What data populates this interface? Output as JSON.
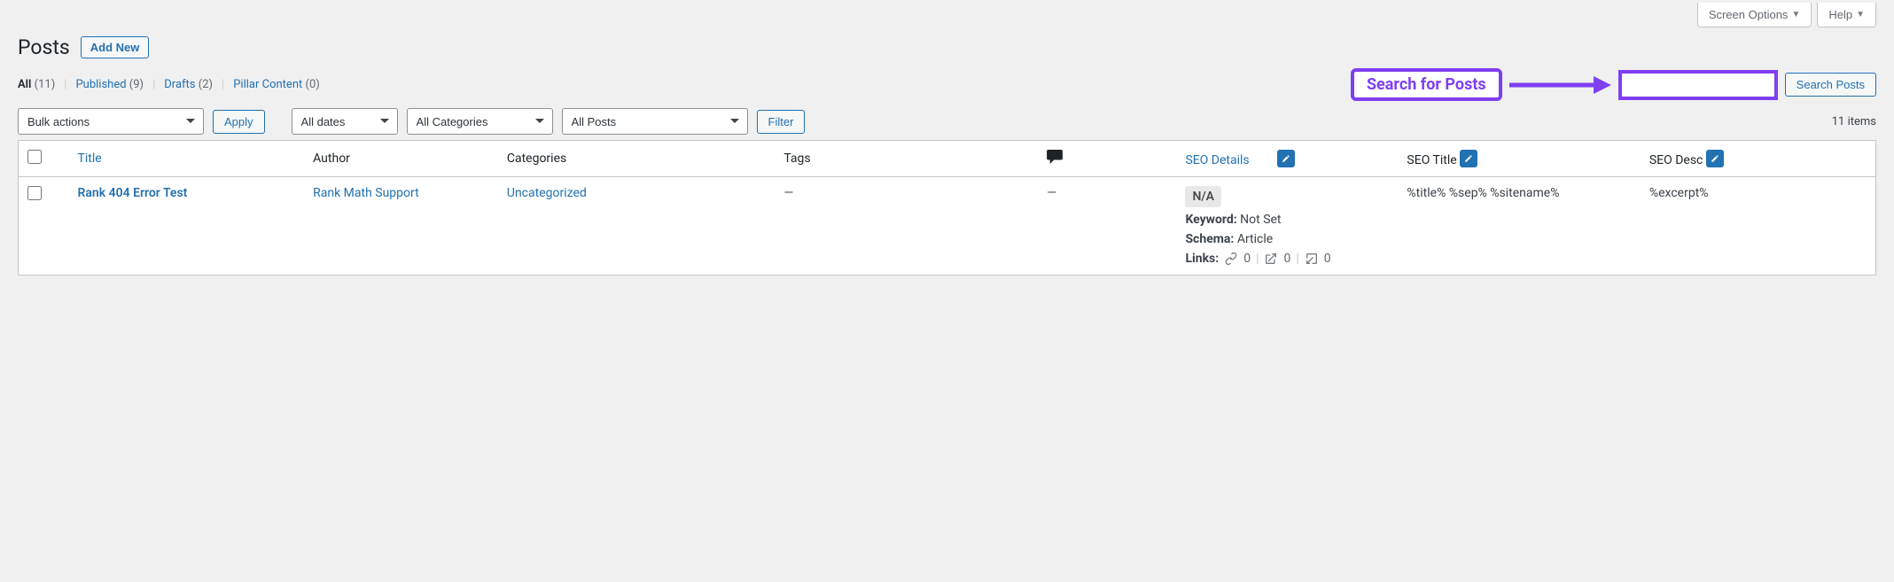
{
  "top_tabs": {
    "screen_options": "Screen Options",
    "help": "Help"
  },
  "page": {
    "title": "Posts",
    "add_new": "Add New"
  },
  "views": {
    "all": {
      "label": "All",
      "count": "(11)"
    },
    "published": {
      "label": "Published",
      "count": "(9)"
    },
    "drafts": {
      "label": "Drafts",
      "count": "(2)"
    },
    "pillar": {
      "label": "Pillar Content",
      "count": "(0)"
    },
    "sep": "|"
  },
  "annotation": {
    "label": "Search for Posts"
  },
  "search": {
    "button": "Search Posts",
    "placeholder": ""
  },
  "filters": {
    "bulk_actions": "Bulk actions",
    "apply": "Apply",
    "all_dates": "All dates",
    "all_categories": "All Categories",
    "all_posts": "All Posts",
    "filter": "Filter",
    "items_count": "11 items"
  },
  "columns": {
    "title": "Title",
    "author": "Author",
    "categories": "Categories",
    "tags": "Tags",
    "seo_details": "SEO Details",
    "seo_title": "SEO Title",
    "seo_desc": "SEO Desc"
  },
  "row": {
    "title": "Rank 404 Error Test",
    "author": "Rank Math Support",
    "category": "Uncategorized",
    "tags": "—",
    "comments": "—",
    "seo": {
      "badge": "N/A",
      "keyword_label": "Keyword:",
      "keyword_value": "Not Set",
      "schema_label": "Schema:",
      "schema_value": "Article",
      "links_label": "Links:",
      "links_internal": "0",
      "links_external": "0",
      "links_incoming": "0"
    },
    "seo_title": "%title% %sep% %sitename%",
    "seo_desc": "%excerpt%"
  }
}
